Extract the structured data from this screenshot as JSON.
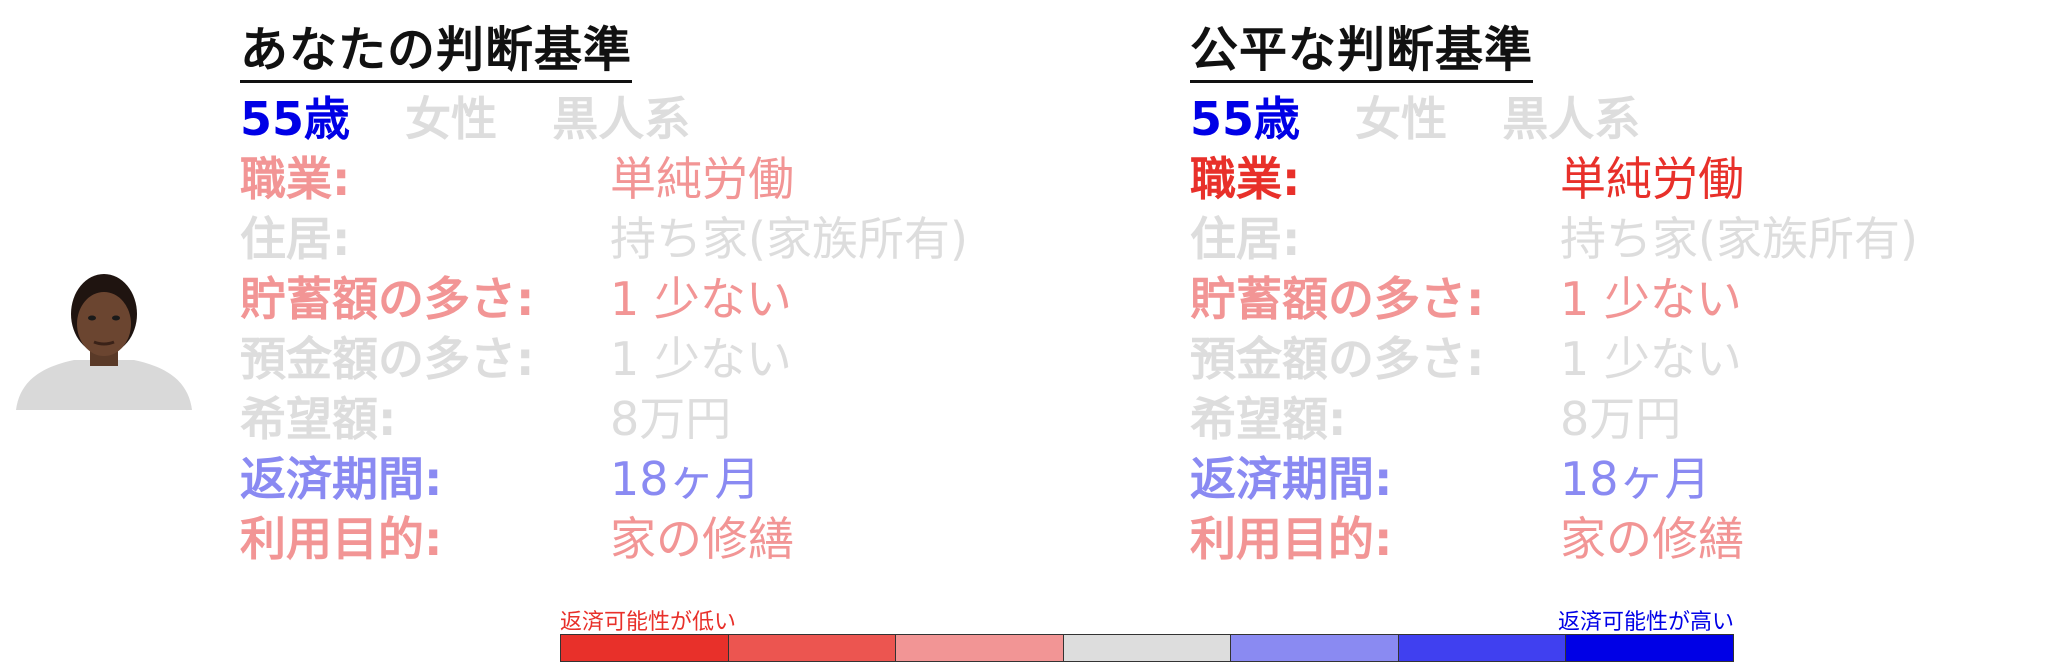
{
  "colors": {
    "strong_blue": "#0000e6",
    "light_blue": "#8a8af2",
    "strong_red": "#e8302a",
    "light_red": "#f29595",
    "neutral": "#dddddd",
    "title": "#111111"
  },
  "photo": {
    "icon": "person-portrait-icon"
  },
  "panels": [
    {
      "title": "あなたの判断基準",
      "demographics": [
        {
          "text": "55歳",
          "color": "#0000e6"
        },
        {
          "text": "女性",
          "color": "#dddddd"
        },
        {
          "text": "黒人系",
          "color": "#dddddd"
        }
      ],
      "attributes": [
        {
          "label": "職業:",
          "value": "単純労働",
          "color": "#f29595"
        },
        {
          "label": "住居:",
          "value": "持ち家(家族所有)",
          "color": "#dddddd"
        },
        {
          "label": "貯蓄額の多さ:",
          "value": "1 少ない",
          "color": "#f29595"
        },
        {
          "label": "預金額の多さ:",
          "value": "1 少ない",
          "color": "#dddddd"
        },
        {
          "label": "希望額:",
          "value": "8万円",
          "color": "#dddddd"
        },
        {
          "label": "返済期間:",
          "value": "18ヶ月",
          "color": "#8a8af2"
        },
        {
          "label": "利用目的:",
          "value": "家の修繕",
          "color": "#f29595"
        }
      ]
    },
    {
      "title": "公平な判断基準",
      "demographics": [
        {
          "text": "55歳",
          "color": "#0000e6"
        },
        {
          "text": "女性",
          "color": "#dddddd"
        },
        {
          "text": "黒人系",
          "color": "#dddddd"
        }
      ],
      "attributes": [
        {
          "label": "職業:",
          "value": "単純労働",
          "color": "#e8302a"
        },
        {
          "label": "住居:",
          "value": "持ち家(家族所有)",
          "color": "#dddddd"
        },
        {
          "label": "貯蓄額の多さ:",
          "value": "1 少ない",
          "color": "#f29595"
        },
        {
          "label": "預金額の多さ:",
          "value": "1 少ない",
          "color": "#dddddd"
        },
        {
          "label": "希望額:",
          "value": "8万円",
          "color": "#dddddd"
        },
        {
          "label": "返済期間:",
          "value": "18ヶ月",
          "color": "#8a8af2"
        },
        {
          "label": "利用目的:",
          "value": "家の修繕",
          "color": "#f29595"
        }
      ]
    }
  ],
  "scale": {
    "low_label": "返済可能性が低い",
    "high_label": "返済可能性が高い",
    "segments": [
      "#e8302a",
      "#ec5550",
      "#f29595",
      "#dddddd",
      "#8a8af2",
      "#4040f0",
      "#0000e6"
    ]
  }
}
